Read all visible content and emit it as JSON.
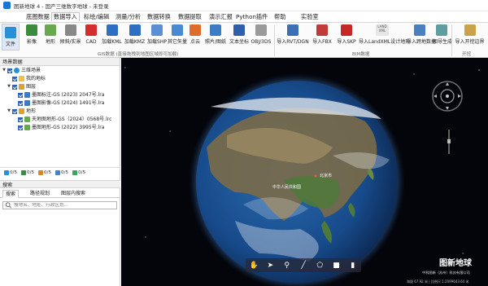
{
  "window": {
    "title": "图新地球 4 - 国产三维数字地球 - 未登录"
  },
  "menu": [
    "底图数据",
    "数据导入",
    "标绘/编辑",
    "测量/分析",
    "数据转换",
    "数据提取",
    "演示汇报",
    "Python插件",
    "帮助",
    "实验室"
  ],
  "ribbon": {
    "file": "文件",
    "buttons": [
      "影像",
      "地形",
      "倾斜/实景",
      "CAD",
      "加载KML",
      "加载KMZ",
      "加载SHP",
      "其它矢量",
      "点云",
      "照片/图纸",
      "文本坐标",
      "OBJ/3DS",
      "导入RVT/DGN",
      "导入FBX",
      "导入SKP",
      "导入LandXML设计地形",
      "导入跨地数据",
      "相导生成",
      "导入开挖边界"
    ],
    "landxml_icon": "LAND\nXML",
    "groups": {
      "gis": "GIS数据 (直接拖拽到地图区域即可加载)",
      "bim": "BIM数据",
      "start": "开挖"
    }
  },
  "scene_panel": {
    "title": "场景数据",
    "nodes": [
      {
        "label": "三维场景"
      },
      {
        "label": "我的地标"
      },
      {
        "label": "图层"
      },
      {
        "label": "墨图标注-GS (2023) 2047号.lra"
      },
      {
        "label": "墨图影像-GS (2024) 1491号.lra"
      },
      {
        "label": "地形"
      },
      {
        "label": "天地图地形-GS（2024）0568号.lrc"
      },
      {
        "label": "墨图地形-GS (2022) 3995号.lra"
      }
    ],
    "counts": [
      "0/5",
      "0/5",
      "0/5",
      "0/5",
      "0/5"
    ]
  },
  "search": {
    "title": "搜索",
    "tabs": [
      "搜索",
      "路径规划",
      "图层内搜索"
    ],
    "placeholder": "搜地名、地址、行政区划..."
  },
  "viewer": {
    "watermark": "图新地球",
    "watermark_sub": "中科图新（苏州）科技有限公司",
    "status": "海拔 67.92 米 | 比例尺 1:2099643.64 米",
    "toolbar": [
      "pan-hand-icon",
      "pointer-icon",
      "pin-icon",
      "draw-line-icon",
      "polygon-icon",
      "area-icon",
      "chart-icon"
    ],
    "label_beijing": "北京市",
    "label_china": "中华人民共和国"
  }
}
